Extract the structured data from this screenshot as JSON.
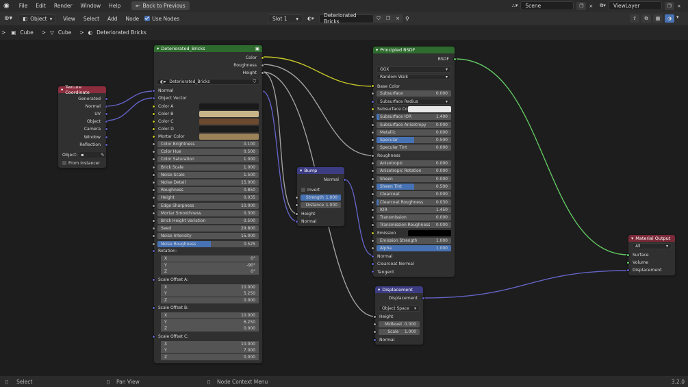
{
  "menu": [
    "File",
    "Edit",
    "Render",
    "Window",
    "Help"
  ],
  "back_button": "Back to Previous",
  "scene": "Scene",
  "view_layer": "ViewLayer",
  "header": {
    "mode": "Object",
    "items": [
      "View",
      "Select",
      "Add",
      "Node"
    ],
    "use_nodes": "Use Nodes",
    "slot": "Slot 1",
    "material": "Deteriorated Bricks"
  },
  "breadcrumb": [
    "Cube",
    "Cube",
    "Deteriorated Bricks"
  ],
  "status": {
    "select": "Select",
    "pan": "Pan View",
    "ctx": "Node Context Menu",
    "version": "3.2.0"
  },
  "colors": {
    "texture_header": "#8b2d3d",
    "group_header": "#2e6b2e",
    "bsdf_header": "#2e6b2e",
    "vector_header": "#3c3c83",
    "output_header": "#7a2a38",
    "wire_color": "#c7c729",
    "wire_gray": "#a1a1a1",
    "wire_vector": "#6363c7",
    "wire_shader": "#63c763"
  },
  "texcoord": {
    "title": "Texture Coordinate",
    "outputs": [
      "Generated",
      "Normal",
      "UV",
      "Object",
      "Camera",
      "Window",
      "Reflection"
    ],
    "object_label": "Object:",
    "from_instancer": "From Instancer"
  },
  "group": {
    "title": "Deteriorated_Bricks",
    "outputs": [
      "Color",
      "Roughness",
      "Height"
    ],
    "datablock": "Deteriorated_Bricks",
    "vec_inputs": [
      "Normal",
      "Object Vector"
    ],
    "color_inputs": [
      {
        "label": "Color A",
        "color": "#1a1a1a"
      },
      {
        "label": "Color B",
        "color": "#c9b48a"
      },
      {
        "label": "Color C",
        "color": "#6b4a30"
      },
      {
        "label": "Color D",
        "color": "#1c1c1c"
      },
      {
        "label": "Mortar Color",
        "color": "#9c8258"
      }
    ],
    "values": [
      {
        "label": "Color Brightness",
        "value": "0.100"
      },
      {
        "label": "Color Hue",
        "value": "0.500"
      },
      {
        "label": "Color Saturation",
        "value": "1.000"
      },
      {
        "label": "Brick Scale",
        "value": "1.000"
      },
      {
        "label": "Noise Scale",
        "value": "1.500"
      },
      {
        "label": "Noise Detail",
        "value": "15.000"
      },
      {
        "label": "Roughness",
        "value": "0.850"
      },
      {
        "label": "Height",
        "value": "0.035"
      },
      {
        "label": "Edge Sharpness",
        "value": "10.000"
      },
      {
        "label": "Mortar Smoothness",
        "value": "0.300"
      },
      {
        "label": "Brick Height Variation",
        "value": "0.500"
      },
      {
        "label": "Seed",
        "value": "29.800"
      },
      {
        "label": "Noise Intensity",
        "value": "15.000"
      },
      {
        "label": "Noise Roughness",
        "value": "0.525",
        "fill": 0.525
      }
    ],
    "vectors": [
      {
        "label": "Rotation:",
        "xyz": [
          [
            "X",
            "0°"
          ],
          [
            "Y",
            "-90°"
          ],
          [
            "Z",
            "0°"
          ]
        ]
      },
      {
        "label": "Scale Offset A:",
        "xyz": [
          [
            "X",
            "10.000"
          ],
          [
            "Y",
            "5.250"
          ],
          [
            "Z",
            "0.000"
          ]
        ]
      },
      {
        "label": "Scale Offset B:",
        "xyz": [
          [
            "X",
            "10.000"
          ],
          [
            "Y",
            "6.250"
          ],
          [
            "Z",
            "0.000"
          ]
        ]
      },
      {
        "label": "Scale Offset C:",
        "xyz": [
          [
            "X",
            "10.000"
          ],
          [
            "Y",
            "7.000"
          ],
          [
            "Z",
            "0.000"
          ]
        ]
      }
    ]
  },
  "bump": {
    "title": "Bump",
    "output": "Normal",
    "invert": "Invert",
    "strength": {
      "label": "Strength",
      "value": "1.000",
      "fill": 1
    },
    "distance": {
      "label": "Distance",
      "value": "1.000"
    },
    "inputs": [
      "Height",
      "Normal"
    ]
  },
  "bsdf": {
    "title": "Principled BSDF",
    "output": "BSDF",
    "distribution": "GGX",
    "subsurface_method": "Random Walk",
    "rows": [
      {
        "label": "Base Color",
        "kind": "label",
        "sock": "y"
      },
      {
        "label": "Subsurface",
        "value": "0.000",
        "sock": "g"
      },
      {
        "label": "Subsurface Radius",
        "kind": "select",
        "sock": "b"
      },
      {
        "label": "Subsurface Colo",
        "kind": "color",
        "color": "#e8e8e8",
        "sock": "y"
      },
      {
        "label": "Subsurface IOR",
        "value": "1.400",
        "sock": "g",
        "fill": 0.04
      },
      {
        "label": "Subsurface Anisotropy",
        "value": "0.000",
        "sock": "g"
      },
      {
        "label": "Metallic",
        "value": "0.000",
        "sock": "g"
      },
      {
        "label": "Specular",
        "value": "0.500",
        "sock": "g",
        "fill": 0.5
      },
      {
        "label": "Specular Tint",
        "value": "0.000",
        "sock": "g"
      },
      {
        "label": "Roughness",
        "kind": "label",
        "sock": "g"
      },
      {
        "label": "Anisotropic",
        "value": "0.000",
        "sock": "g"
      },
      {
        "label": "Anisotropic Rotation",
        "value": "0.000",
        "sock": "g"
      },
      {
        "label": "Sheen",
        "value": "0.000",
        "sock": "g"
      },
      {
        "label": "Sheen Tint",
        "value": "0.500",
        "sock": "g",
        "fill": 0.5
      },
      {
        "label": "Clearcoat",
        "value": "0.000",
        "sock": "g"
      },
      {
        "label": "Clearcoat Roughness",
        "value": "0.030",
        "sock": "g",
        "fill": 0.03
      },
      {
        "label": "IOR",
        "value": "1.450",
        "sock": "g"
      },
      {
        "label": "Transmission",
        "value": "0.000",
        "sock": "g"
      },
      {
        "label": "Transmission Roughness",
        "value": "0.000",
        "sock": "g"
      },
      {
        "label": "Emission",
        "kind": "color",
        "color": "#000000",
        "sock": "y"
      },
      {
        "label": "Emission Strength",
        "value": "1.000",
        "sock": "g"
      },
      {
        "label": "Alpha",
        "value": "1.000",
        "sock": "g",
        "fill": 1
      },
      {
        "label": "Normal",
        "kind": "label",
        "sock": "b"
      },
      {
        "label": "Clearcoat Normal",
        "kind": "label",
        "sock": "b"
      },
      {
        "label": "Tangent",
        "kind": "label",
        "sock": "b"
      }
    ]
  },
  "output": {
    "title": "Material Output",
    "target": "All",
    "inputs": [
      "Surface",
      "Volume",
      "Displacement"
    ]
  },
  "disp": {
    "title": "Displacement",
    "output": "Displacement",
    "space": "Object Space",
    "height": "Height",
    "midlevel": {
      "label": "Midlevel",
      "value": "0.000"
    },
    "scale": {
      "label": "Scale",
      "value": "1.000"
    },
    "normal": "Normal"
  }
}
